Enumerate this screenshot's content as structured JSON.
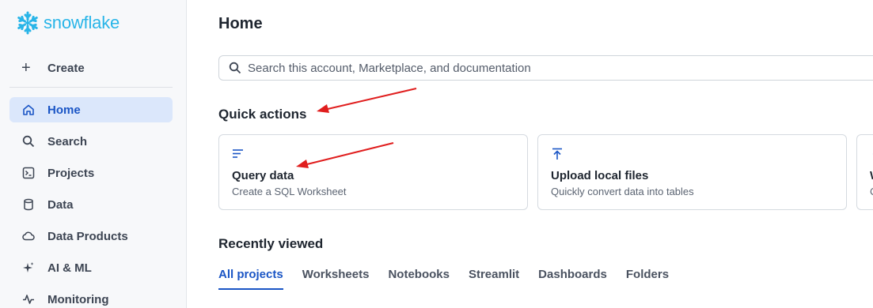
{
  "brand": {
    "name": "snowflake",
    "color": "#29b5e8"
  },
  "sidebar": {
    "create_label": "Create",
    "items": [
      {
        "label": "Home",
        "icon": "home-icon",
        "active": true
      },
      {
        "label": "Search",
        "icon": "search-icon"
      },
      {
        "label": "Projects",
        "icon": "terminal-icon"
      },
      {
        "label": "Data",
        "icon": "database-icon"
      },
      {
        "label": "Data Products",
        "icon": "cloud-icon"
      },
      {
        "label": "AI & ML",
        "icon": "sparkle-icon"
      },
      {
        "label": "Monitoring",
        "icon": "activity-icon"
      }
    ]
  },
  "main": {
    "title": "Home",
    "search": {
      "placeholder": "Search this account, Marketplace, and documentation"
    },
    "quick_actions": {
      "title": "Quick actions",
      "cards": [
        {
          "title": "Query data",
          "subtitle": "Create a SQL Worksheet",
          "icon": "lines-icon"
        },
        {
          "title": "Upload local files",
          "subtitle": "Quickly convert data into tables",
          "icon": "upload-icon"
        },
        {
          "title": "W",
          "subtitle": "C",
          "icon": "chevron-left-icon"
        }
      ]
    },
    "recently_viewed": {
      "title": "Recently viewed",
      "tabs": [
        "All projects",
        "Worksheets",
        "Notebooks",
        "Streamlit",
        "Dashboards",
        "Folders"
      ],
      "active_tab": "All projects"
    }
  },
  "colors": {
    "accent": "#1a55c5",
    "active_bg": "#dbe7fb",
    "annotation": "#e01e1e"
  }
}
